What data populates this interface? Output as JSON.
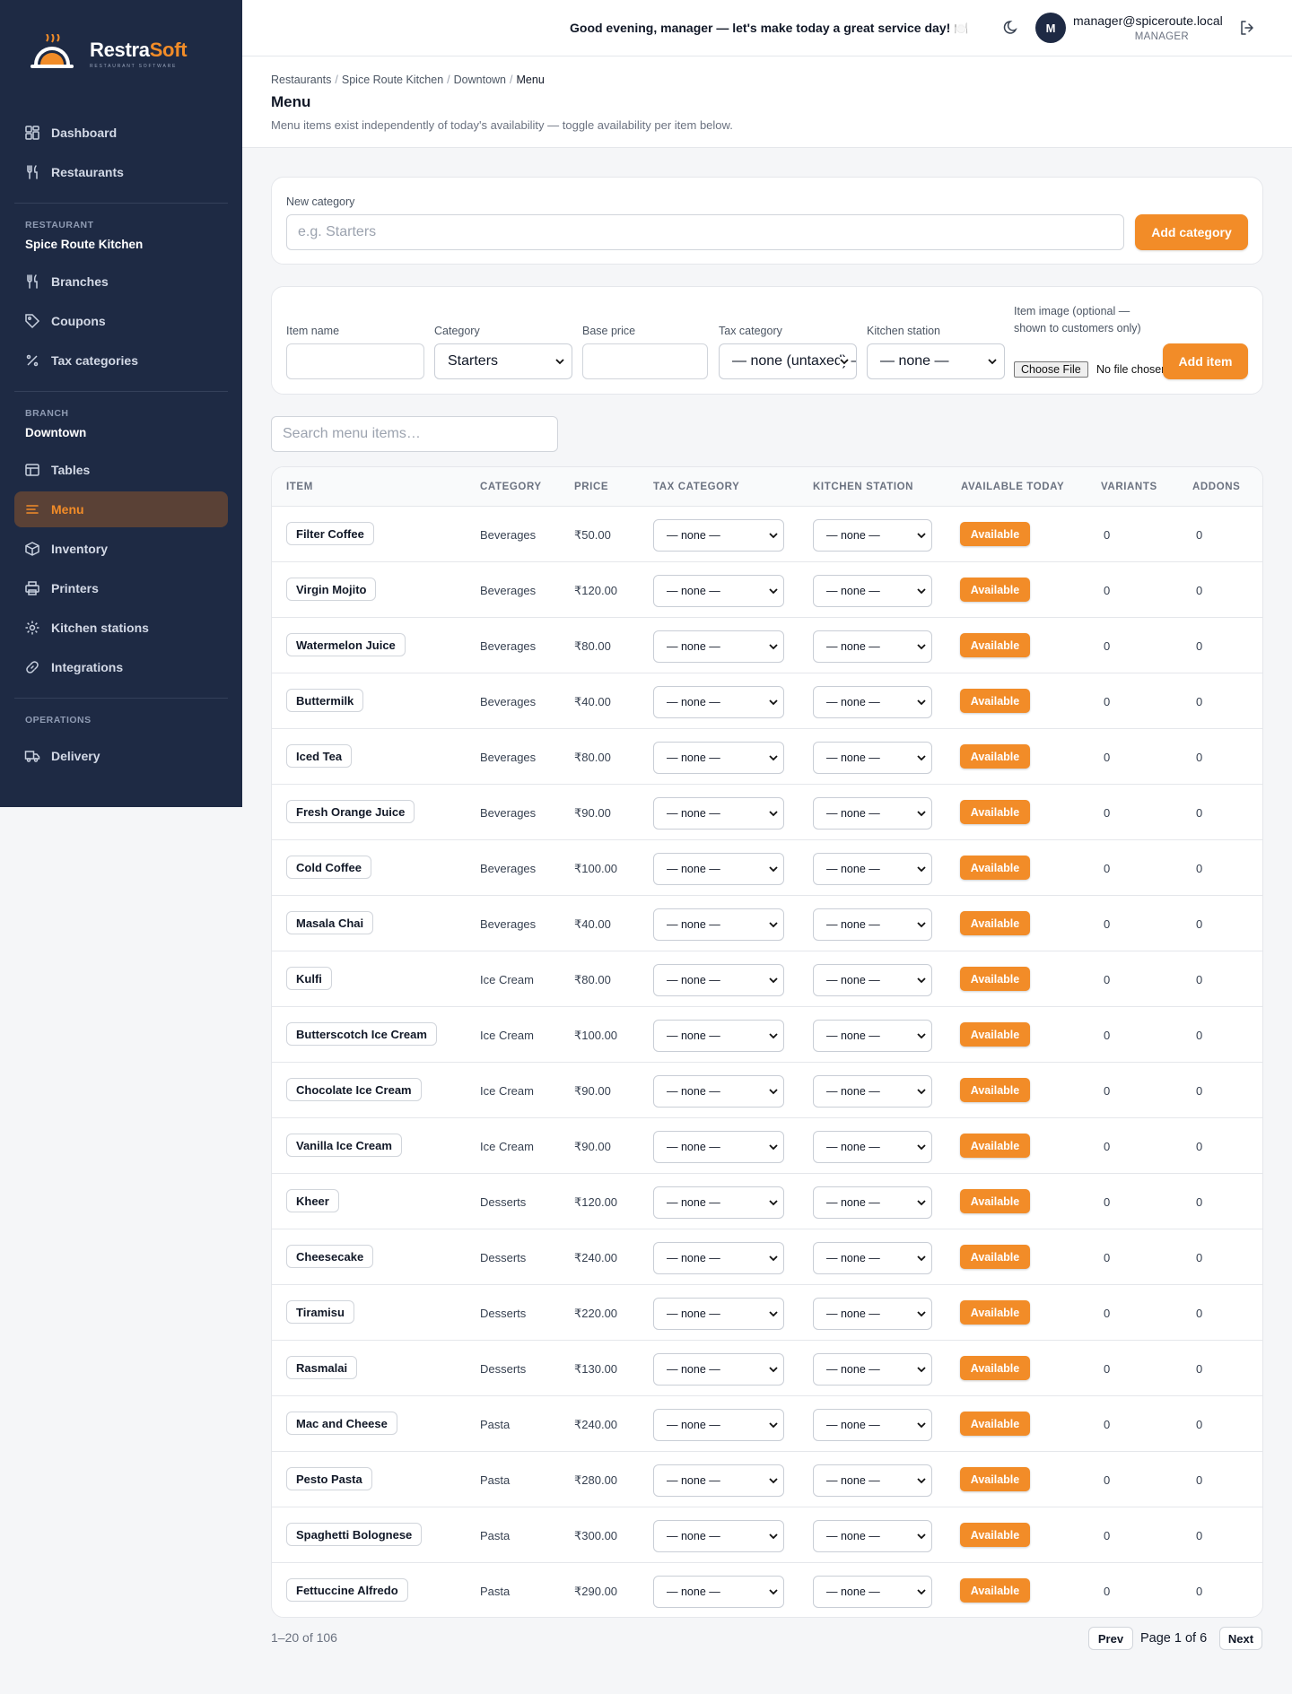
{
  "app": {
    "name_part1": "Restra",
    "name_part2": "Soft",
    "tagline": "RESTAURANT SOFTWARE",
    "accent": "#f28c28",
    "sidebar_bg": "#1e2a44"
  },
  "sidebar": {
    "top_items": [
      {
        "label": "Dashboard",
        "icon": "dashboard-icon"
      },
      {
        "label": "Restaurants",
        "icon": "utensils-icon"
      }
    ],
    "restaurant_section": {
      "label": "RESTAURANT",
      "name": "Spice Route Kitchen"
    },
    "restaurant_items": [
      {
        "label": "Branches",
        "icon": "utensils-icon"
      },
      {
        "label": "Coupons",
        "icon": "tag-icon"
      },
      {
        "label": "Tax categories",
        "icon": "percent-icon"
      }
    ],
    "branch_section": {
      "label": "BRANCH",
      "name": "Downtown"
    },
    "branch_items": [
      {
        "label": "Tables",
        "icon": "table-icon"
      },
      {
        "label": "Menu",
        "icon": "menu-list-icon",
        "active": true
      },
      {
        "label": "Inventory",
        "icon": "box-icon"
      },
      {
        "label": "Printers",
        "icon": "printer-icon"
      },
      {
        "label": "Kitchen stations",
        "icon": "gear-icon"
      },
      {
        "label": "Integrations",
        "icon": "link-icon"
      }
    ],
    "operations_section": {
      "label": "OPERATIONS"
    },
    "operations_items": [
      {
        "label": "Delivery",
        "icon": "truck-icon"
      }
    ]
  },
  "topbar": {
    "greeting": "Good evening, manager — let's make today a great service day!",
    "greeting_emoji": "🍽️",
    "avatar_letter": "M",
    "email": "manager@spiceroute.local",
    "role": "MANAGER"
  },
  "header": {
    "breadcrumbs": [
      "Restaurants",
      "Spice Route Kitchen",
      "Downtown",
      "Menu"
    ],
    "title": "Menu",
    "subtitle": "Menu items exist independently of today's availability — toggle availability per item below."
  },
  "new_category": {
    "label": "New category",
    "placeholder": "e.g. Starters",
    "button": "Add category"
  },
  "new_item": {
    "name_label": "Item name",
    "category_label": "Category",
    "category_value": "Starters",
    "price_label": "Base price",
    "tax_label": "Tax category",
    "tax_value": "— none (untaxed) —",
    "station_label": "Kitchen station",
    "station_value": "— none —",
    "image_label": "Item image (optional — shown to customers only)",
    "file_button": "Choose File",
    "file_text": "No file chosen",
    "button": "Add item"
  },
  "search": {
    "placeholder": "Search menu items…"
  },
  "table": {
    "headers": [
      "ITEM",
      "CATEGORY",
      "PRICE",
      "TAX CATEGORY",
      "KITCHEN STATION",
      "AVAILABLE TODAY",
      "VARIANTS",
      "ADDONS"
    ],
    "select_value": "— none —",
    "available_label": "Available",
    "rows": [
      {
        "name": "Filter Coffee",
        "category": "Beverages",
        "price": "₹50.00",
        "variants": "0",
        "addons": "0"
      },
      {
        "name": "Virgin Mojito",
        "category": "Beverages",
        "price": "₹120.00",
        "variants": "0",
        "addons": "0"
      },
      {
        "name": "Watermelon Juice",
        "category": "Beverages",
        "price": "₹80.00",
        "variants": "0",
        "addons": "0"
      },
      {
        "name": "Buttermilk",
        "category": "Beverages",
        "price": "₹40.00",
        "variants": "0",
        "addons": "0"
      },
      {
        "name": "Iced Tea",
        "category": "Beverages",
        "price": "₹80.00",
        "variants": "0",
        "addons": "0"
      },
      {
        "name": "Fresh Orange Juice",
        "category": "Beverages",
        "price": "₹90.00",
        "variants": "0",
        "addons": "0"
      },
      {
        "name": "Cold Coffee",
        "category": "Beverages",
        "price": "₹100.00",
        "variants": "0",
        "addons": "0"
      },
      {
        "name": "Masala Chai",
        "category": "Beverages",
        "price": "₹40.00",
        "variants": "0",
        "addons": "0"
      },
      {
        "name": "Kulfi",
        "category": "Ice Cream",
        "price": "₹80.00",
        "variants": "0",
        "addons": "0"
      },
      {
        "name": "Butterscotch Ice Cream",
        "category": "Ice Cream",
        "price": "₹100.00",
        "variants": "0",
        "addons": "0"
      },
      {
        "name": "Chocolate Ice Cream",
        "category": "Ice Cream",
        "price": "₹90.00",
        "variants": "0",
        "addons": "0"
      },
      {
        "name": "Vanilla Ice Cream",
        "category": "Ice Cream",
        "price": "₹90.00",
        "variants": "0",
        "addons": "0"
      },
      {
        "name": "Kheer",
        "category": "Desserts",
        "price": "₹120.00",
        "variants": "0",
        "addons": "0"
      },
      {
        "name": "Cheesecake",
        "category": "Desserts",
        "price": "₹240.00",
        "variants": "0",
        "addons": "0"
      },
      {
        "name": "Tiramisu",
        "category": "Desserts",
        "price": "₹220.00",
        "variants": "0",
        "addons": "0"
      },
      {
        "name": "Rasmalai",
        "category": "Desserts",
        "price": "₹130.00",
        "variants": "0",
        "addons": "0"
      },
      {
        "name": "Mac and Cheese",
        "category": "Pasta",
        "price": "₹240.00",
        "variants": "0",
        "addons": "0"
      },
      {
        "name": "Pesto Pasta",
        "category": "Pasta",
        "price": "₹280.00",
        "variants": "0",
        "addons": "0"
      },
      {
        "name": "Spaghetti Bolognese",
        "category": "Pasta",
        "price": "₹300.00",
        "variants": "0",
        "addons": "0"
      },
      {
        "name": "Fettuccine Alfredo",
        "category": "Pasta",
        "price": "₹290.00",
        "variants": "0",
        "addons": "0"
      }
    ]
  },
  "pagination": {
    "count": "1–20 of 106",
    "prev": "Prev",
    "page_text": "Page 1 of 6",
    "next": "Next"
  }
}
